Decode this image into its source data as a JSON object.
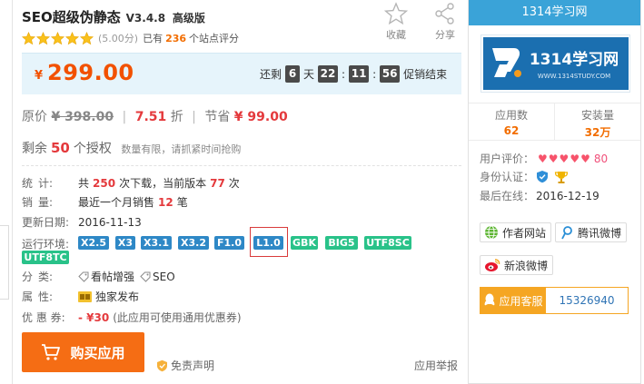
{
  "app": {
    "name": "SEO超级伪静态",
    "version": "V3.4.8",
    "level": "高级版",
    "rating_score": "(5.00分)",
    "rating_prefix": "已有",
    "rating_count": "236",
    "rating_suffix": "个站点评分",
    "favorite_label": "收藏",
    "share_label": "分享"
  },
  "price": {
    "currency": "¥",
    "amount": "299.00",
    "countdown_prefix": "还剩",
    "days": "6",
    "days_unit": "天",
    "hours": "22",
    "minutes": "11",
    "seconds": "56",
    "countdown_suffix": "促销结束"
  },
  "original": {
    "label": "原价",
    "value": "¥ 398.00",
    "discount": "7.51",
    "discount_unit": "折",
    "save_label": "节省",
    "save_value": "¥ 99.00",
    "separator": "|"
  },
  "remain": {
    "prefix": "剩余",
    "count": "50",
    "suffix": "个授权",
    "note": "数量有限，请抓紧时间抢购"
  },
  "stats": {
    "label_a": "统",
    "label_b": "计:",
    "text1": "共",
    "downloads": "250",
    "text2": "次下载，当前版本",
    "current": "77",
    "text3": "次"
  },
  "sales": {
    "label_a": "销",
    "label_b": "量:",
    "text1": "最近一个月销售",
    "count": "12",
    "text2": "笔"
  },
  "updated": {
    "label": "更新日期:",
    "value": "2016-11-13"
  },
  "environments": {
    "label": "运行环境:",
    "tags": [
      {
        "text": "X2.5",
        "color": "blue"
      },
      {
        "text": "X3",
        "color": "blue"
      },
      {
        "text": "X3.1",
        "color": "blue"
      },
      {
        "text": "X3.2",
        "color": "blue"
      },
      {
        "text": "F1.0",
        "color": "blue"
      },
      {
        "text": "L1.0",
        "color": "blue"
      },
      {
        "text": "GBK",
        "color": "green"
      },
      {
        "text": "BIG5",
        "color": "green"
      },
      {
        "text": "UTF8SC",
        "color": "green"
      },
      {
        "text": "UTF8TC",
        "color": "green"
      }
    ],
    "highlight_color": "#d93b3b"
  },
  "category": {
    "label_a": "分",
    "label_b": "类:",
    "items": [
      "看帖增强",
      "SEO"
    ]
  },
  "attribute": {
    "label_a": "属",
    "label_b": "性:",
    "value": "独家发布"
  },
  "coupon": {
    "label": "优 惠 券:",
    "value": "- ¥30",
    "note": "(此应用可使用通用优惠券)"
  },
  "actions": {
    "buy_label": "购买应用",
    "disclaimer_label": "免责声明",
    "report_label": "应用举报"
  },
  "sidebar": {
    "title": "1314学习网",
    "logo_text": "1314学习网",
    "logo_url_text": "WWW.1314STUDY.COM",
    "apps_label": "应用数",
    "apps_value": "62",
    "installs_label": "安装量",
    "installs_value": "32万",
    "user_rating_label": "用户评价：",
    "user_rating_value": "80",
    "identity_label": "身份认证：",
    "last_online_label": "最后在线：",
    "last_online_value": "2016-12-19",
    "author_site_label": "作者网站",
    "tencent_weibo_label": "腾讯微博",
    "sina_weibo_label": "新浪微博",
    "service_label": "应用客服",
    "service_number": "15326940"
  },
  "colors": {
    "accent_orange": "#f56d14",
    "price_red": "#f25100",
    "header_blue": "#3aa3d8",
    "tag_blue": "#2e88c6",
    "tag_green": "#29c289",
    "service_orange": "#f5a623"
  }
}
